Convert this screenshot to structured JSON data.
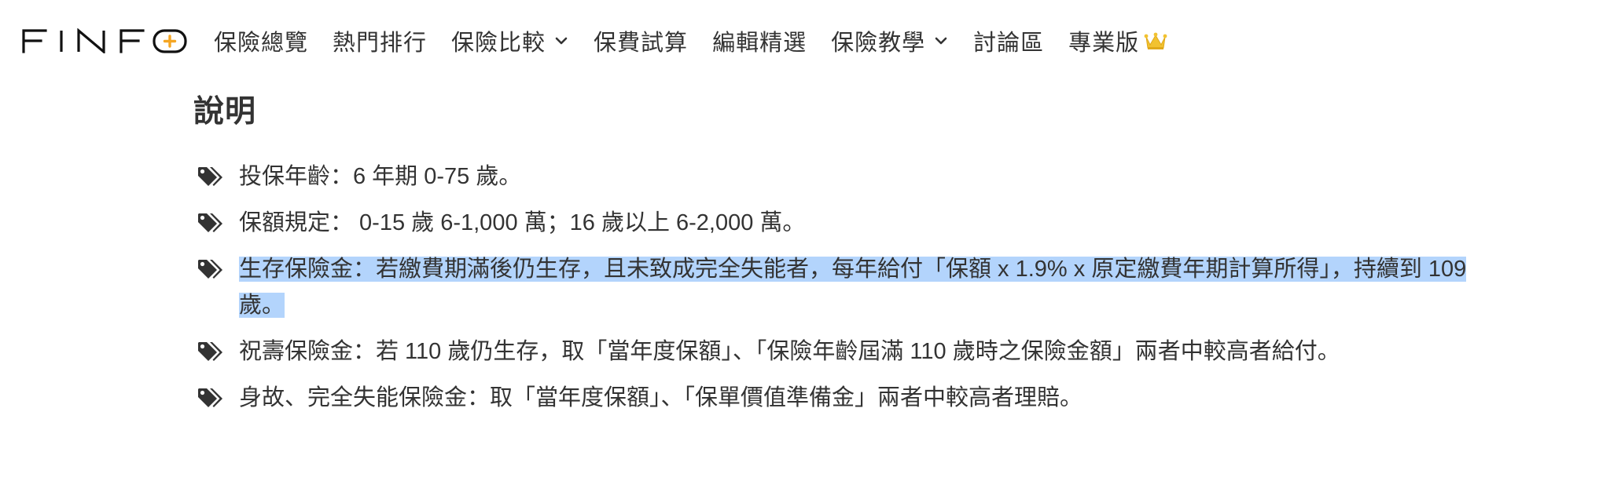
{
  "brand": {
    "logo_text": "FINFO",
    "accent_color": "#f5a623"
  },
  "nav": {
    "items": [
      {
        "label": "保險總覽",
        "dropdown": false
      },
      {
        "label": "熱門排行",
        "dropdown": false
      },
      {
        "label": "保險比較",
        "dropdown": true
      },
      {
        "label": "保費試算",
        "dropdown": false
      },
      {
        "label": "編輯精選",
        "dropdown": false
      },
      {
        "label": "保險教學",
        "dropdown": true
      },
      {
        "label": "討論區",
        "dropdown": false
      },
      {
        "label": "專業版",
        "dropdown": false,
        "icon": "crown-icon"
      }
    ]
  },
  "section": {
    "title": "說明",
    "items": [
      {
        "text": "投保年齡：6 年期 0-75 歲。",
        "icon": "tags-icon",
        "selected": false
      },
      {
        "text": "保額規定： 0-15 歲 6-1,000 萬；16 歲以上 6-2,000 萬。",
        "icon": "tags-icon",
        "selected": false
      },
      {
        "text": "生存保險金：若繳費期滿後仍生存，且未致成完全失能者，每年給付「保額 x 1.9% x 原定繳費年期計算所得」，持續到 109 歲。",
        "icon": "tags-icon",
        "selected": true
      },
      {
        "text": "祝壽保險金：若 110 歲仍生存，取「當年度保額」、「保險年齡屆滿 110 歲時之保險金額」兩者中較高者給付。",
        "icon": "tags-icon",
        "selected": false
      },
      {
        "text": "身故、完全失能保險金：取「當年度保額」、「保單價值準備金」兩者中較高者理賠。",
        "icon": "tags-icon",
        "selected": false
      }
    ]
  },
  "colors": {
    "text": "#333333",
    "selection": "#b3d4fc",
    "crown": "#f2c230"
  }
}
